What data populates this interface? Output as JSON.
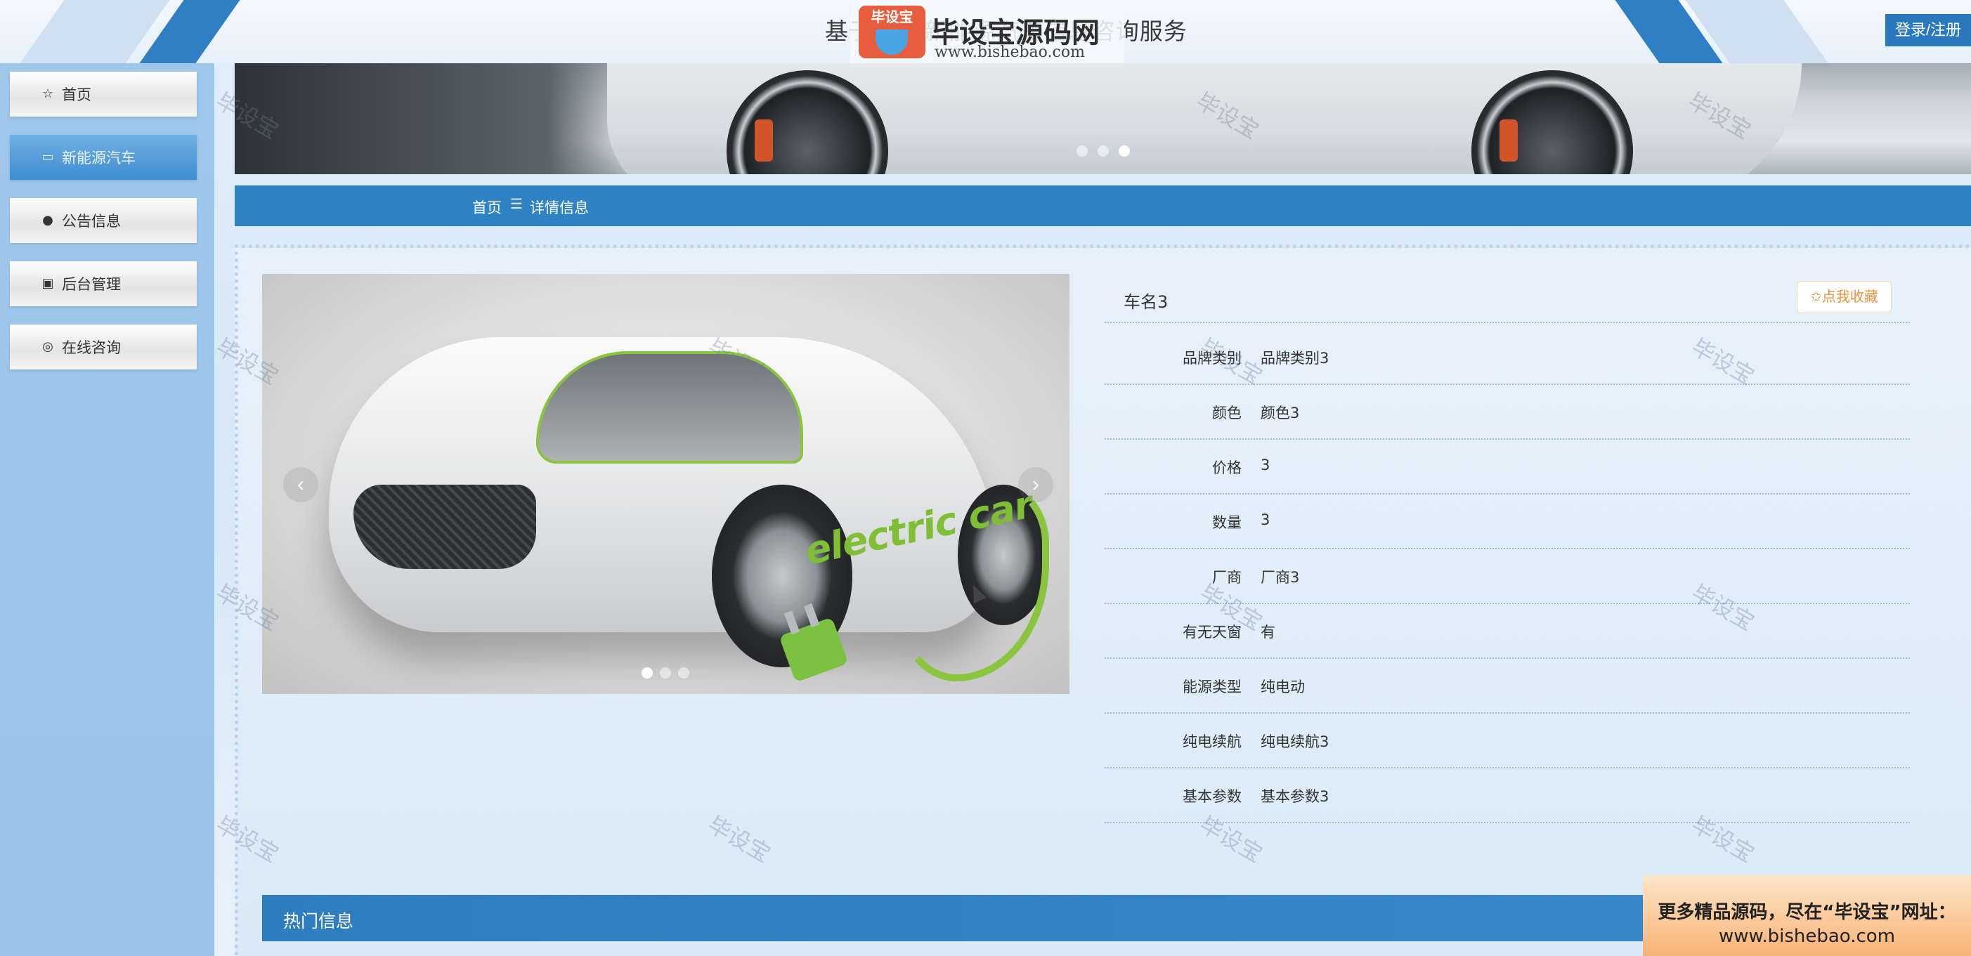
{
  "header": {
    "title": "基于Java新能源汽车信息咨询服务",
    "logo_badge": "毕设宝",
    "logo_name": "毕设宝源码网",
    "logo_url": "www.bishebao.com",
    "login_label": "登录/注册"
  },
  "sidebar": {
    "items": [
      {
        "label": "首页",
        "icon": "☆"
      },
      {
        "label": "新能源汽车",
        "icon": "▭"
      },
      {
        "label": "公告信息",
        "icon": "●"
      },
      {
        "label": "后台管理",
        "icon": "▣"
      },
      {
        "label": "在线咨询",
        "icon": "◎"
      }
    ]
  },
  "breadcrumb": {
    "home": "首页",
    "separator": "☰",
    "current": "详情信息"
  },
  "detail": {
    "name": "车名3",
    "favorite_label": "✩点我收藏",
    "rows": [
      {
        "label": "品牌类别",
        "value": "品牌类别3"
      },
      {
        "label": "颜色",
        "value": "颜色3"
      },
      {
        "label": "价格",
        "value": "3"
      },
      {
        "label": "数量",
        "value": "3"
      },
      {
        "label": "厂商",
        "value": "厂商3"
      },
      {
        "label": "有无天窗",
        "value": "有"
      },
      {
        "label": "能源类型",
        "value": "纯电动"
      },
      {
        "label": "纯电续航",
        "value": "纯电续航3"
      },
      {
        "label": "基本参数",
        "value": "基本参数3"
      }
    ]
  },
  "product_image": {
    "brand_text": "electric car",
    "prev_icon": "‹",
    "next_icon": "›"
  },
  "hot": {
    "title": "热门信息"
  },
  "promo": {
    "line1": "更多精品源码，尽在“毕设宝”网址：",
    "line2": "www.bishebao.com"
  },
  "watermark": "毕设宝",
  "colors": {
    "primary_blue": "#2f82c3",
    "sidebar_bg": "#9fc7ea",
    "favorite_orange": "#e8923c"
  }
}
